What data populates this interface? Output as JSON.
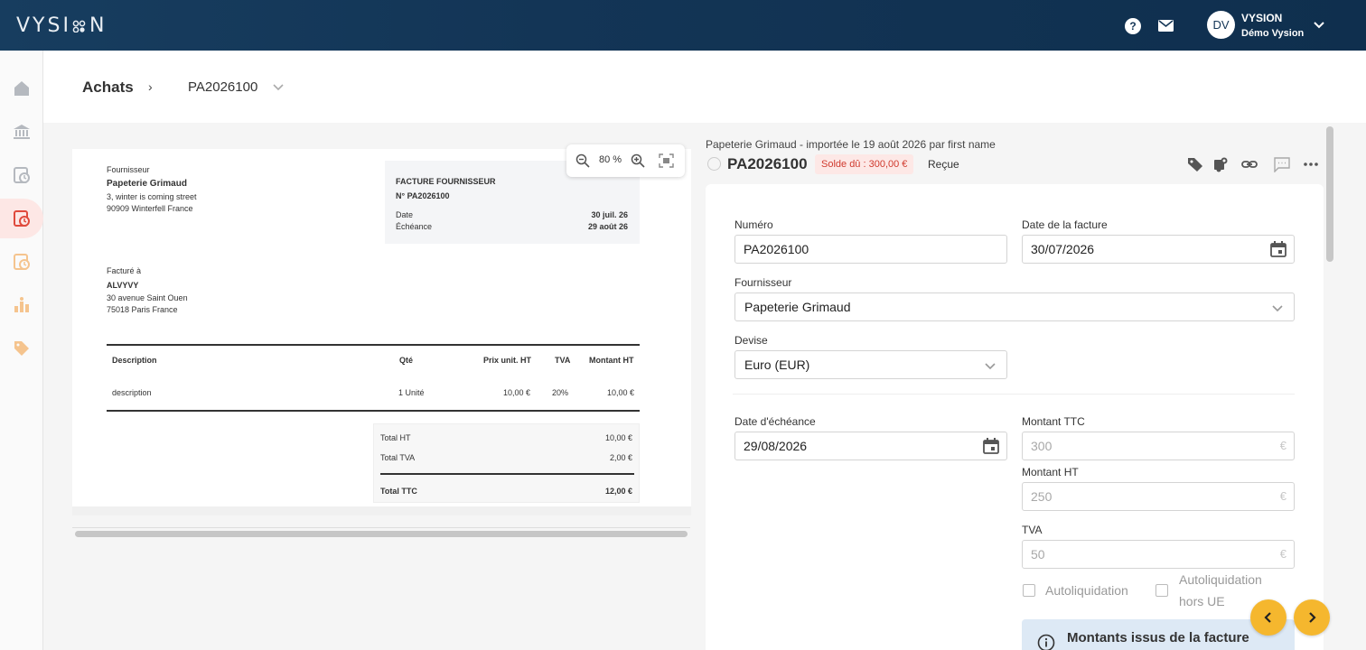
{
  "app": {
    "logo": "VYSI N"
  },
  "topbar": {
    "help_symbol": "?",
    "user": {
      "initials": "DV",
      "name": "VYSION",
      "org": "Démo Vysion"
    }
  },
  "sidebar": {
    "items": [
      {
        "icon": "home-icon",
        "active": false
      },
      {
        "icon": "bank-icon",
        "active": false
      },
      {
        "icon": "sales-invoice-icon",
        "active": false
      },
      {
        "icon": "purchase-invoice-icon",
        "active": true
      },
      {
        "icon": "expense-icon",
        "active": false
      },
      {
        "icon": "reports-icon",
        "active": false
      },
      {
        "icon": "tag-icon",
        "active": false
      }
    ]
  },
  "breadcrumb": {
    "root": "Achats",
    "separator": "›",
    "current": "PA2026100"
  },
  "document": {
    "supplier_label": "Fournisseur",
    "supplier_name": "Papeterie Grimaud",
    "supplier_addr1": "3, winter is coming street",
    "supplier_addr2": "90909 Winterfell France",
    "invoice_heading": "FACTURE FOURNISSEUR",
    "invoice_number": "N° PA2026100",
    "date_label": "Date",
    "date_value": "30 juil. 26",
    "due_label": "Échéance",
    "due_value": "29 août 26",
    "billed_label": "Facturé à",
    "billed_name": "ALVYVY",
    "billed_addr1": "30 avenue Saint Ouen",
    "billed_addr2": "75018 Paris France",
    "table": {
      "headers": {
        "description": "Description",
        "qty": "Qté",
        "unit_price": "Prix unit. HT",
        "vat": "TVA",
        "amount": "Montant HT"
      },
      "rows": [
        {
          "description": "description",
          "qty": "1 Unité",
          "unit_price": "10,00 €",
          "vat": "20%",
          "amount": "10,00 €"
        }
      ]
    },
    "totals": {
      "ht_label": "Total HT",
      "ht_value": "10,00 €",
      "tva_label": "Total TVA",
      "tva_value": "2,00 €",
      "ttc_label": "Total TTC",
      "ttc_value": "12,00 €"
    },
    "zoom": "80 %"
  },
  "invoice_header": {
    "imported_text": "Papeterie Grimaud - importée le 19 août 2026 par first name",
    "title": "PA2026100",
    "solde": "Solde dû : 300,00 €",
    "status": "Reçue"
  },
  "form": {
    "numero_label": "Numéro",
    "numero_value": "PA2026100",
    "date_label": "Date de la facture",
    "date_value": "30/07/2026",
    "supplier_label": "Fournisseur",
    "supplier_value": "Papeterie Grimaud",
    "currency_label": "Devise",
    "currency_value": "Euro (EUR)",
    "due_label": "Date d'échéance",
    "due_value": "29/08/2026",
    "ttc_label": "Montant TTC",
    "ttc_value": "300",
    "ht_label": "Montant HT",
    "ht_value": "250",
    "tva_label": "TVA",
    "tva_value": "50",
    "currency_symbol": "€",
    "autoliq_label": "Autoliquidation",
    "autoliq_hors_ue_label_1": "Autoliquidation",
    "autoliq_hors_ue_label_2": "hors UE",
    "info_text": "Montants issus de la facture"
  },
  "colors": {
    "accent": "#f5b72e",
    "danger": "#d03a2e",
    "topbar": "#133556",
    "active_red": "#e04a3c"
  }
}
